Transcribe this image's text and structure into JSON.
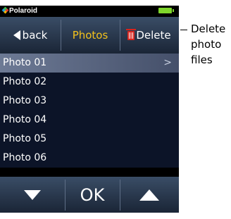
{
  "status": {
    "brand": "Polaroid"
  },
  "topbar": {
    "back_label": "back",
    "title": "Photos",
    "delete_label": "Delete"
  },
  "list": {
    "items": [
      "Photo 01",
      "Photo 02",
      "Photo 03",
      "Photo 04",
      "Photo 05",
      "Photo 06"
    ],
    "selected_index": 0
  },
  "bottombar": {
    "ok_label": "OK"
  },
  "annotation": {
    "lines": [
      "Delete",
      "photo",
      "files"
    ]
  },
  "colors": {
    "accent": "#f3c21c",
    "battery": "#7fd62c",
    "trash": "#d8231c"
  }
}
